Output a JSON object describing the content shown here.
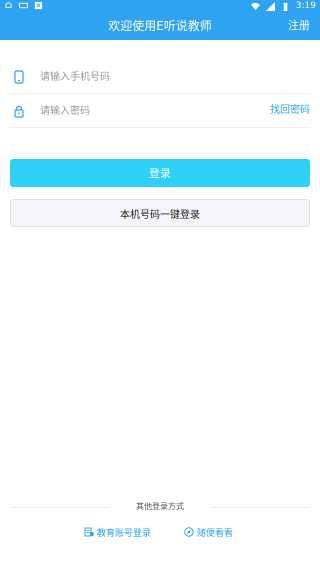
{
  "status_bar": {
    "time": "3:19",
    "icons": [
      "notification-icon",
      "keyboard-icon",
      "app-icon",
      "wifi-icon",
      "signal-icon",
      "battery-icon"
    ]
  },
  "header": {
    "title": "欢迎使用E听说教师",
    "register_label": "注册"
  },
  "form": {
    "phone_placeholder": "请输入手机号码",
    "phone_icon": "phone-icon",
    "password_placeholder": "请输入密码",
    "password_icon": "lock-icon",
    "forgot_label": "找回密码"
  },
  "buttons": {
    "login_label": "登录",
    "oneclick_label": "本机号码一键登录"
  },
  "other_login": {
    "label": "其他登录方式",
    "edu_label": "教育账号登录",
    "edu_icon": "edu-account-icon",
    "browse_label": "随便看看",
    "browse_icon": "compass-icon"
  },
  "colors": {
    "brand": "#2ea3f2",
    "login_button": "#2fd0f8",
    "secondary_button": "#f3f5f8"
  }
}
